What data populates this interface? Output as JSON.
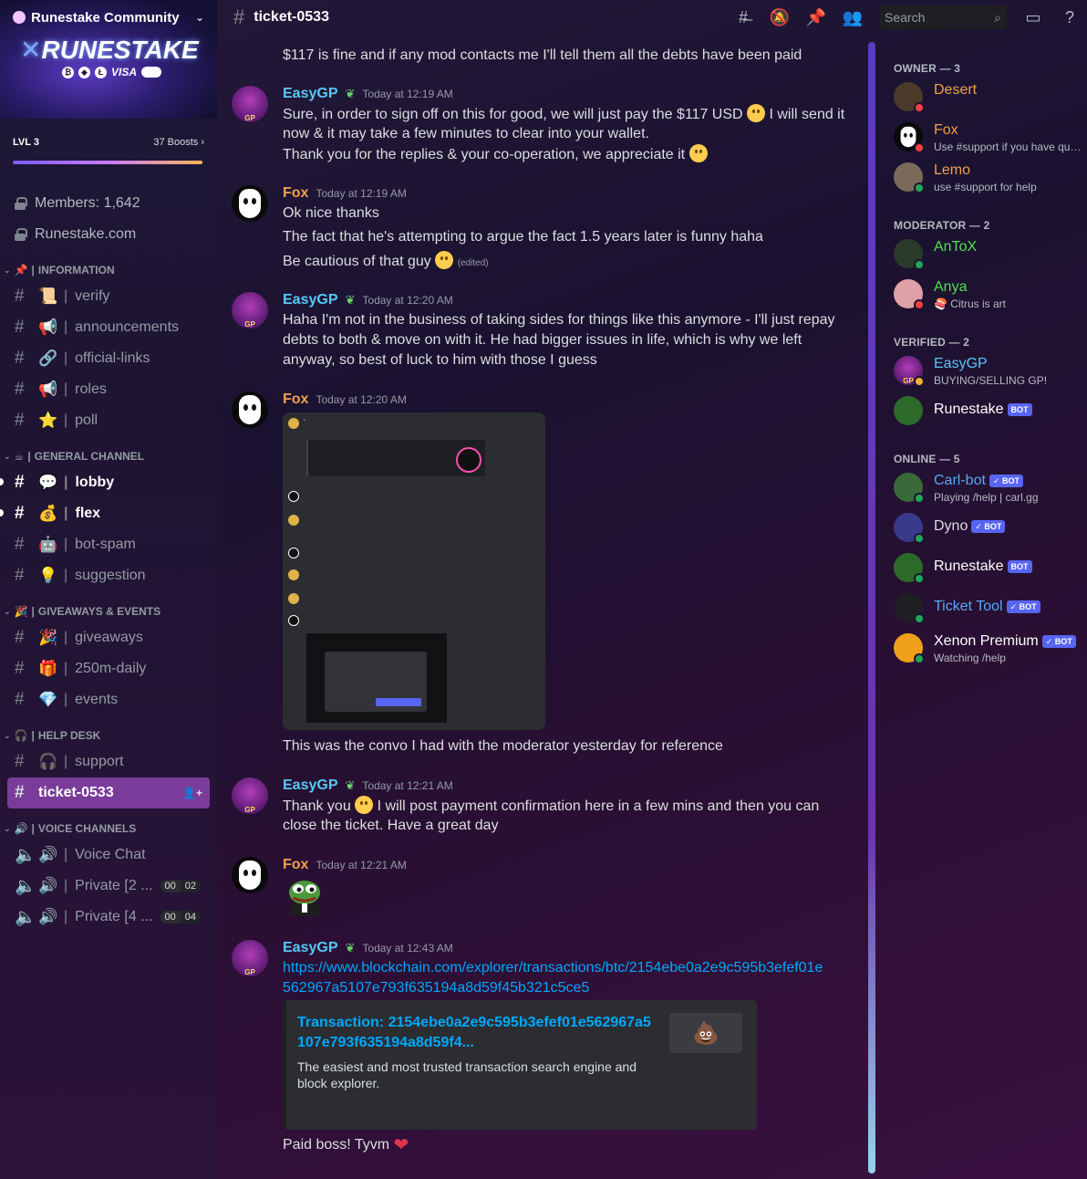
{
  "server": {
    "name": "Runestake Community",
    "banner_logo": "RUNESTAKE",
    "banner_pay": "VISA"
  },
  "boost": {
    "level": "LVL 3",
    "count": "37 Boosts"
  },
  "static_channels": [
    {
      "label": "Members: 1,642"
    },
    {
      "label": "Runestake.com"
    }
  ],
  "categories": {
    "information": "INFORMATION",
    "general": "GENERAL CHANNEL",
    "giveaways": "GIVEAWAYS & EVENTS",
    "helpdesk": "HELP DESK",
    "voice": "VOICE CHANNELS"
  },
  "channels": {
    "verify": "verify",
    "announcements": "announcements",
    "official_links": "official-links",
    "roles": "roles",
    "poll": "poll",
    "lobby": "lobby",
    "flex": "flex",
    "bot_spam": "bot-spam",
    "suggestion": "suggestion",
    "giveaways": "giveaways",
    "daily": "250m-daily",
    "events": "events",
    "support": "support",
    "ticket": "ticket-0533",
    "voice_chat": "Voice Chat",
    "private2": "Private [2 ...",
    "private4": "Private [4 ..."
  },
  "voice_badges": {
    "p2_a": "00",
    "p2_b": "02",
    "p4_a": "00",
    "p4_b": "04"
  },
  "topbar": {
    "channel": "ticket-0533",
    "search_placeholder": "Search"
  },
  "messages": {
    "m0_line": "$117 is fine and if any mod contacts me I'll tell them all the debts have been paid",
    "m1_user": "EasyGP",
    "m1_time": "Today at 12:19 AM",
    "m1_l1a": "Sure, in order to sign off on this for good, we will just pay the $117 USD",
    "m1_l1b": "I will send it",
    "m1_l2": "now & it may take a few minutes to clear into your wallet.",
    "m1_l3": "Thank you for the replies & your co-operation, we appreciate it",
    "m2_user": "Fox",
    "m2_time": "Today at 12:19 AM",
    "m2_l1": "Ok nice thanks",
    "m2_l2": "The fact that he's attempting to argue the fact 1.5 years later is funny haha",
    "m2_l3": "Be cautious of that guy",
    "m2_edited": "(edited)",
    "m3_user": "EasyGP",
    "m3_time": "Today at 12:20 AM",
    "m3_l1": "Haha I'm not in the business of taking sides for things like this anymore - I'll just repay",
    "m3_l2": "debts to both & move on with it. He had bigger issues in life, which is why we left",
    "m3_l3": "anyway, so best of luck to him with those I guess",
    "m4_user": "Fox",
    "m4_time": "Today at 12:20 AM",
    "m4_caption": "This was the convo I had with the moderator yesterday for reference",
    "m5_user": "EasyGP",
    "m5_time": "Today at 12:21 AM",
    "m5_l1a": "Thank you",
    "m5_l1b": "I will post payment confirmation here in a few mins and then you can",
    "m5_l2": "close the ticket. Have a great day",
    "m6_user": "Fox",
    "m6_time": "Today at 12:21 AM",
    "m7_user": "EasyGP",
    "m7_time": "Today at 12:43 AM",
    "m7_link1": "https://www.blockchain.com/explorer/transactions/btc/2154ebe0a2e9c595b3efef01e",
    "m7_link2": "562967a5107e793f635194a8d59f45b321c5ce5",
    "m7_embed_title": "Transaction: 2154ebe0a2e9c595b3efef01e562967a5107e793f635194a8d59f4...",
    "m7_embed_desc": "The easiest and most trusted transaction search engine and block explorer.",
    "m7_final": "Paid boss! Tyvm"
  },
  "members": {
    "owner_header": "OWNER — 3",
    "moderator_header": "MODERATOR — 2",
    "verified_header": "VERIFIED — 2",
    "online_header": "ONLINE — 5",
    "desert": "Desert",
    "fox": "Fox",
    "fox_status": "Use #support if you have que...",
    "lemo": "Lemo",
    "lemo_status": "use #support for help",
    "antox": "AnToX",
    "anya": "Anya",
    "anya_status": "Citrus is art",
    "easygp": "EasyGP",
    "easygp_status": "BUYING/SELLING GP!",
    "runestake": "Runestake",
    "carlbot": "Carl-bot",
    "carlbot_status": "Playing /help | carl.gg",
    "dyno": "Dyno",
    "runestake2": "Runestake",
    "tickettool": "Ticket Tool",
    "xenon": "Xenon Premium",
    "xenon_status": "Watching /help",
    "bot_tag": "BOT",
    "bot_tag_check": "✓ BOT"
  },
  "colors": {
    "accent": "#5865f2",
    "owner": "#f0a04a",
    "moderator": "#4ee04e",
    "active_channel": "#7a3c9a",
    "link": "#00a8fc"
  }
}
